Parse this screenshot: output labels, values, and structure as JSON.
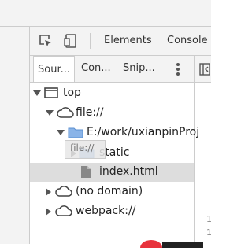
{
  "toolbar": {
    "tabs": [
      "Elements",
      "Console"
    ]
  },
  "sources_tabs": {
    "tabs": [
      "Sour...",
      "Con...",
      "Snip..."
    ]
  },
  "tree": {
    "nodes": [
      {
        "label": "top",
        "icon": "frame-icon"
      },
      {
        "label": "file://",
        "icon": "cloud-icon"
      },
      {
        "label": "E:/work/uxianpinProj",
        "icon": "folder-icon"
      },
      {
        "label": "static",
        "icon": "folder-icon"
      },
      {
        "label": "index.html",
        "icon": "file-icon"
      },
      {
        "label": "(no domain)",
        "icon": "cloud-icon"
      },
      {
        "label": "webpack://",
        "icon": "cloud-icon"
      }
    ],
    "drag_ghost": "file://"
  },
  "right_panel": {
    "line_numbers": [
      "1",
      "1"
    ]
  },
  "colors": {
    "folder": "#8ab4e8",
    "badge": "#e8323c",
    "selected_row": "#dddddd"
  }
}
